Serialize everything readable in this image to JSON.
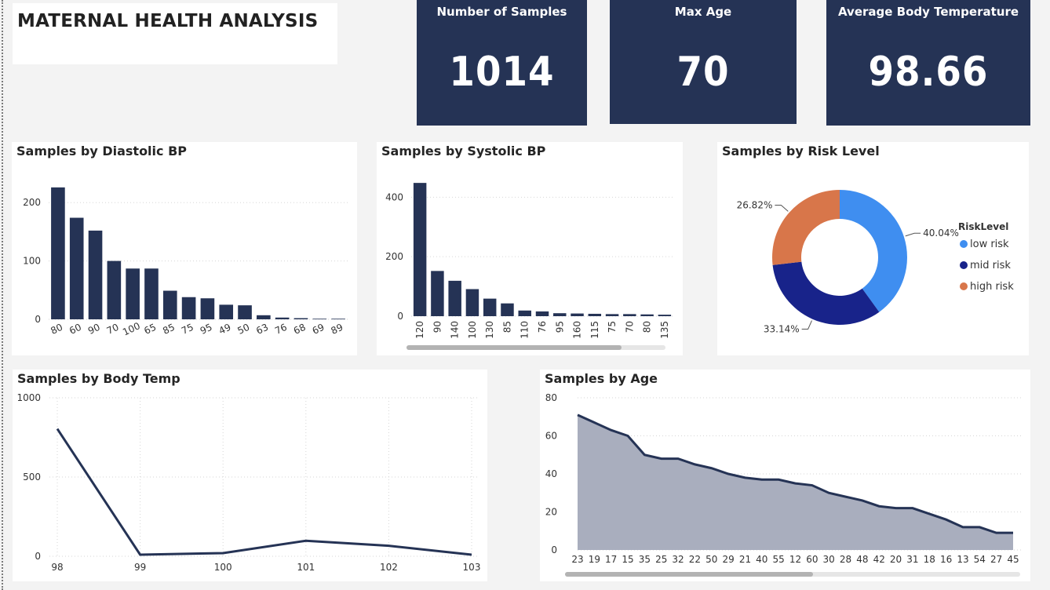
{
  "title": "MATERNAL HEALTH ANALYSIS",
  "kpis": [
    {
      "label": "Number of Samples",
      "value": "1014"
    },
    {
      "label": "Max Age",
      "value": "70"
    },
    {
      "label": "Average Body Temperature",
      "value": "98.66"
    }
  ],
  "colors": {
    "navy": "#253355",
    "kpi_bg": "#253355",
    "low": "#3f8ef0",
    "mid": "#18238a",
    "high": "#d8764a",
    "area_fill": "#a9aebe"
  },
  "chart_data": [
    {
      "type": "bar",
      "title": "Samples by Diastolic BP",
      "categories": [
        "80",
        "60",
        "90",
        "70",
        "100",
        "65",
        "85",
        "75",
        "95",
        "49",
        "50",
        "63",
        "76",
        "68",
        "69",
        "89"
      ],
      "values": [
        226,
        174,
        152,
        100,
        87,
        87,
        49,
        38,
        36,
        25,
        24,
        7,
        3,
        2,
        1,
        1
      ],
      "ylim": [
        0,
        250
      ],
      "yticks": [
        0,
        100,
        200
      ],
      "grid": true
    },
    {
      "type": "bar",
      "title": "Samples by Systolic BP",
      "categories": [
        "120",
        "90",
        "140",
        "100",
        "130",
        "85",
        "110",
        "76",
        "95",
        "160",
        "115",
        "75",
        "70",
        "80",
        "135"
      ],
      "values": [
        448,
        152,
        119,
        91,
        59,
        43,
        19,
        16,
        10,
        9,
        8,
        7,
        7,
        6,
        5
      ],
      "ylim": [
        0,
        480
      ],
      "yticks": [
        0,
        200,
        400
      ],
      "grid": true
    },
    {
      "type": "pie",
      "title": "Samples by Risk Level",
      "legend_title": "RiskLevel",
      "legend_position": "right",
      "labels": [
        "low risk",
        "mid risk",
        "high risk"
      ],
      "values": [
        40.04,
        33.14,
        26.82
      ],
      "value_labels": [
        "40.04%",
        "33.14%",
        "26.82%"
      ]
    },
    {
      "type": "line",
      "title": "Samples by Body Temp",
      "x": [
        "98",
        "99",
        "100",
        "101",
        "102",
        "103"
      ],
      "y": [
        804,
        10,
        20,
        98,
        66,
        10
      ],
      "ylim": [
        0,
        1000
      ],
      "yticks": [
        0,
        500,
        1000
      ],
      "grid": true
    },
    {
      "type": "area",
      "title": "Samples by Age",
      "x": [
        "23",
        "19",
        "17",
        "15",
        "35",
        "25",
        "32",
        "22",
        "50",
        "29",
        "21",
        "40",
        "55",
        "12",
        "60",
        "30",
        "28",
        "48",
        "42",
        "20",
        "31",
        "18",
        "16",
        "13",
        "54",
        "27",
        "45"
      ],
      "y": [
        71,
        67,
        63,
        60,
        50,
        48,
        48,
        45,
        43,
        40,
        38,
        37,
        37,
        35,
        34,
        30,
        28,
        26,
        23,
        22,
        22,
        19,
        16,
        12,
        12,
        9,
        9
      ],
      "ylim": [
        0,
        80
      ],
      "yticks": [
        0,
        20,
        40,
        60,
        80
      ],
      "grid": true
    }
  ]
}
